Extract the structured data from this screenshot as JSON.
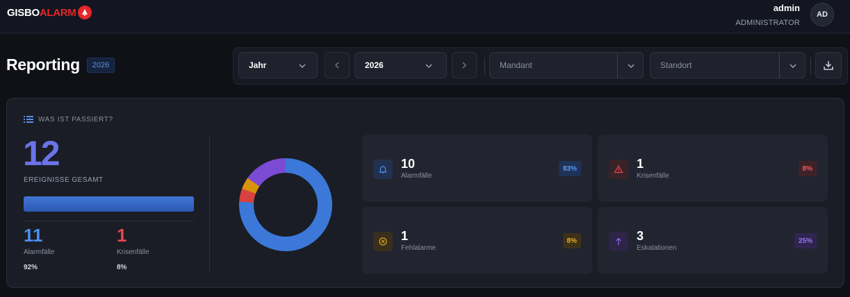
{
  "app": {
    "logo_part1": "GISBO",
    "logo_part2": "ALARM"
  },
  "user": {
    "name": "admin",
    "role": "ADMINISTRATOR",
    "initials": "AD"
  },
  "page": {
    "title": "Reporting",
    "year_badge": "2026"
  },
  "filters": {
    "period": "Jahr",
    "year": "2026",
    "mandant_placeholder": "Mandant",
    "standort_placeholder": "Standort"
  },
  "summary": {
    "section_title": "WAS IST PASSIERT?",
    "total": "12",
    "total_label": "EREIGNISSE GESAMT",
    "alarm_count": "11",
    "alarm_label": "Alarmfälle",
    "alarm_pct": "92%",
    "krisen_count": "1",
    "krisen_label": "Krisenfälle",
    "krisen_pct": "8%"
  },
  "donut": {
    "segments": [
      {
        "value": 10,
        "color": "#3b78d8"
      },
      {
        "value": 0.6,
        "color": "#d8413f"
      },
      {
        "value": 0.55,
        "color": "#d9920e"
      },
      {
        "value": 2,
        "color": "#7b4bd6"
      }
    ]
  },
  "stats": [
    {
      "count": "10",
      "label": "Alarmfälle",
      "pct": "83%",
      "icon": "bell-icon",
      "accent": "#4d8ef0"
    },
    {
      "count": "1",
      "label": "Krisenfälle",
      "pct": "8%",
      "icon": "warning-icon",
      "accent": "#e5484d"
    },
    {
      "count": "1",
      "label": "Fehlalarme",
      "pct": "8%",
      "icon": "x-circle-icon",
      "accent": "#e0a21a"
    },
    {
      "count": "3",
      "label": "Eskalationen",
      "pct": "25%",
      "icon": "arrow-up-icon",
      "accent": "#8b63ee"
    }
  ],
  "colors": {
    "background": "#0f1117",
    "card": "#1a1d25",
    "primary_blue": "#3b78d8",
    "total_number": "#6a73e8",
    "danger": "#e5484d"
  }
}
